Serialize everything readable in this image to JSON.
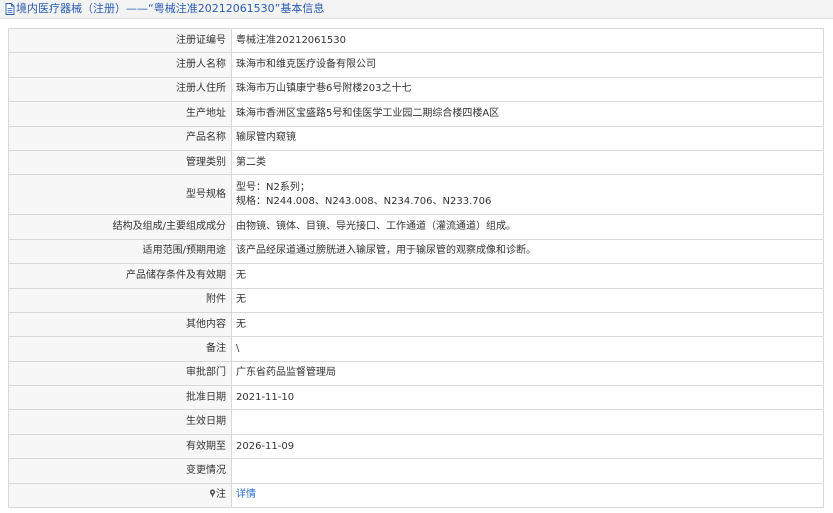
{
  "header": {
    "breadcrumb": "境内医疗器械（注册）——“粤械注准20212061530”基本信息",
    "icon": "document-icon"
  },
  "rows": [
    {
      "label": "注册证编号",
      "value": "粤械注准20212061530"
    },
    {
      "label": "注册人名称",
      "value": "珠海市和维克医疗设备有限公司"
    },
    {
      "label": "注册人住所",
      "value": "珠海市万山镇康宁巷6号附楼203之十七"
    },
    {
      "label": "生产地址",
      "value": "珠海市香洲区宝盛路5号和佳医学工业园二期综合楼四楼A区"
    },
    {
      "label": "产品名称",
      "value": "输尿管内窥镜"
    },
    {
      "label": "管理类别",
      "value": "第二类"
    },
    {
      "label": "型号规格",
      "value_line1": "型号：N2系列；",
      "value_line2": "规格：N244.008、N243.008、N234.706、N233.706"
    },
    {
      "label": "结构及组成/主要组成成分",
      "value": "由物镜、镜体、目镜、导光接口、工作通道（灌流通道）组成。"
    },
    {
      "label": "适用范围/预期用途",
      "value": "该产品经尿道通过膀胱进入输尿管，用于输尿管的观察成像和诊断。"
    },
    {
      "label": "产品储存条件及有效期",
      "value": "无"
    },
    {
      "label": "附件",
      "value": "无"
    },
    {
      "label": "其他内容",
      "value": "无"
    },
    {
      "label": "备注",
      "value": "\\"
    },
    {
      "label": "审批部门",
      "value": "广东省药品监督管理局"
    },
    {
      "label": "批准日期",
      "value": "2021-11-10"
    },
    {
      "label": "生效日期",
      "value": ""
    },
    {
      "label": "有效期至",
      "value": "2026-11-09"
    },
    {
      "label": "变更情况",
      "value": ""
    },
    {
      "label": "注",
      "icon": "pin-icon",
      "link": "详情"
    }
  ],
  "colors": {
    "link": "#2a6dc9",
    "header_text": "#2a5db0",
    "border": "#d8d8d8",
    "label_bg": "#f7f7f7"
  }
}
